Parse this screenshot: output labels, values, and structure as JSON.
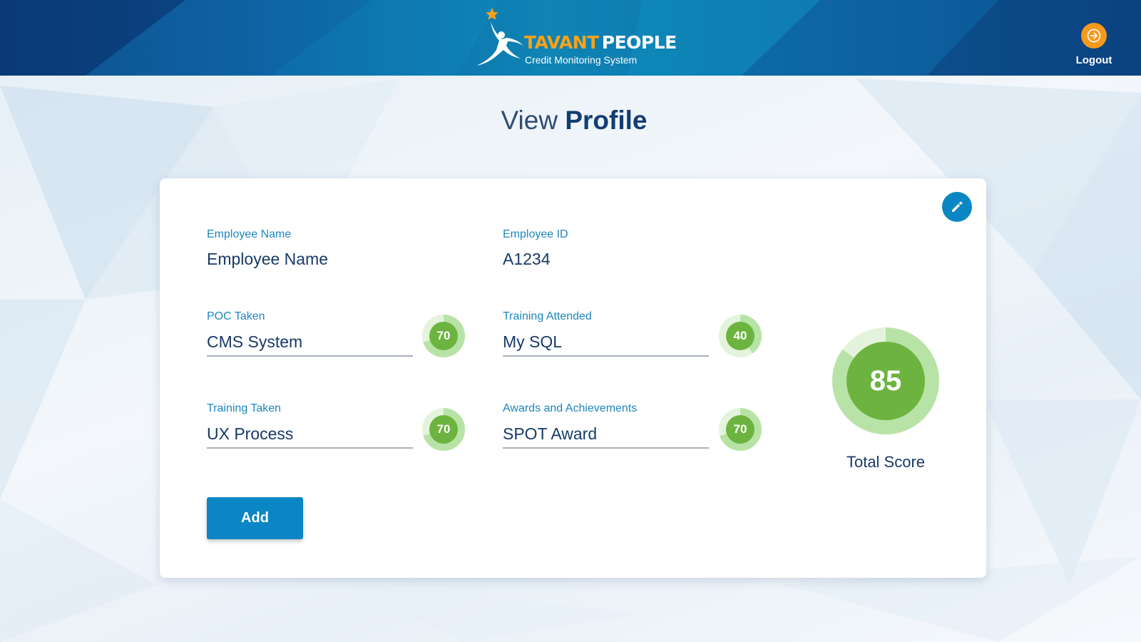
{
  "colors": {
    "brand_orange": "#f7a21b",
    "primary_blue": "#0a86c4",
    "label_blue": "#1d86c0",
    "text_navy": "#173a68",
    "score_green": "#6cb43f",
    "score_green_light": "#b8e3a6"
  },
  "header": {
    "brand_part1": "TAVANT",
    "brand_part2": "PEOPLE",
    "subtitle": "Credit Monitoring System",
    "logo_icon": "star-person-icon",
    "logout_label": "Logout",
    "logout_icon": "logout-arrow-icon"
  },
  "page": {
    "title_light": "View",
    "title_bold": "Profile"
  },
  "profile": {
    "edit_icon": "pencil-icon",
    "employee_name": {
      "label": "Employee Name",
      "value": "Employee Name"
    },
    "employee_id": {
      "label": "Employee ID",
      "value": "A1234"
    },
    "poc_taken": {
      "label": "POC Taken",
      "value": "CMS System",
      "score": "70",
      "score_fraction": 0.7
    },
    "training_attended": {
      "label": "Training Attended",
      "value": "My SQL",
      "score": "40",
      "score_fraction": 0.4
    },
    "training_taken": {
      "label": "Training Taken",
      "value": "UX Process",
      "score": "70",
      "score_fraction": 0.7
    },
    "awards": {
      "label": "Awards and Achievements",
      "value": "SPOT Award",
      "score": "70",
      "score_fraction": 0.7
    },
    "total_score": {
      "value": "85",
      "label": "Total Score",
      "fraction": 0.85
    },
    "add_label": "Add"
  }
}
